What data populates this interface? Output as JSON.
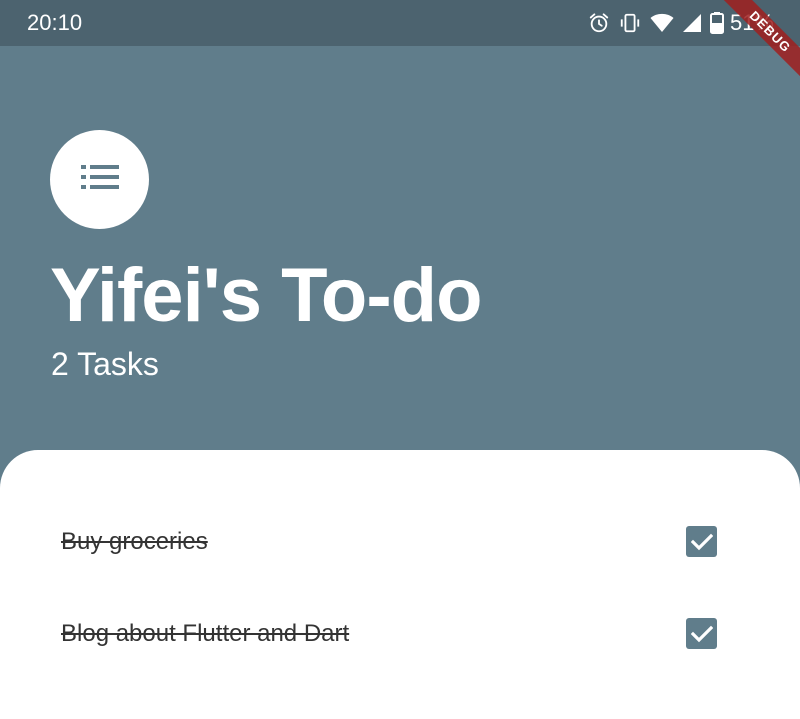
{
  "status_bar": {
    "time": "20:10",
    "icons": [
      "alarm-icon",
      "vibrate-icon",
      "wifi-icon",
      "signal-icon",
      "battery-icon"
    ],
    "battery": "51%"
  },
  "debug_banner": "DEBUG",
  "header": {
    "menu_icon": "list-icon",
    "title": "Yifei's To-do",
    "task_count": "2 Tasks"
  },
  "tasks": [
    {
      "title": "Buy groceries",
      "done": true
    },
    {
      "title": "Blog about Flutter and Dart",
      "done": true
    }
  ],
  "colors": {
    "primary": "#607d8b",
    "status_bar": "#4c636f",
    "sheet": "#ffffff",
    "debug": "#a01e1e"
  }
}
